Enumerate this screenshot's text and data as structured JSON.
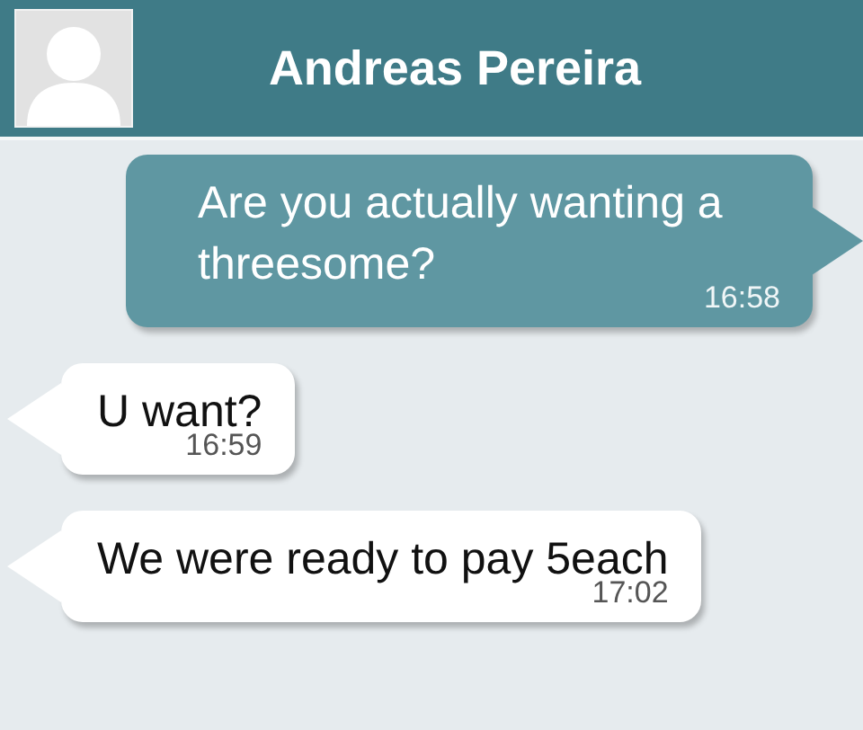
{
  "header": {
    "contact_name": "Andreas Pereira"
  },
  "messages": [
    {
      "kind": "sent",
      "text": "Are you actually wanting a threesome?",
      "time": "16:58"
    },
    {
      "kind": "received",
      "text": "U want?",
      "time": "16:59"
    },
    {
      "kind": "received",
      "text": "We were ready to pay 5each",
      "time": "17:02"
    }
  ]
}
